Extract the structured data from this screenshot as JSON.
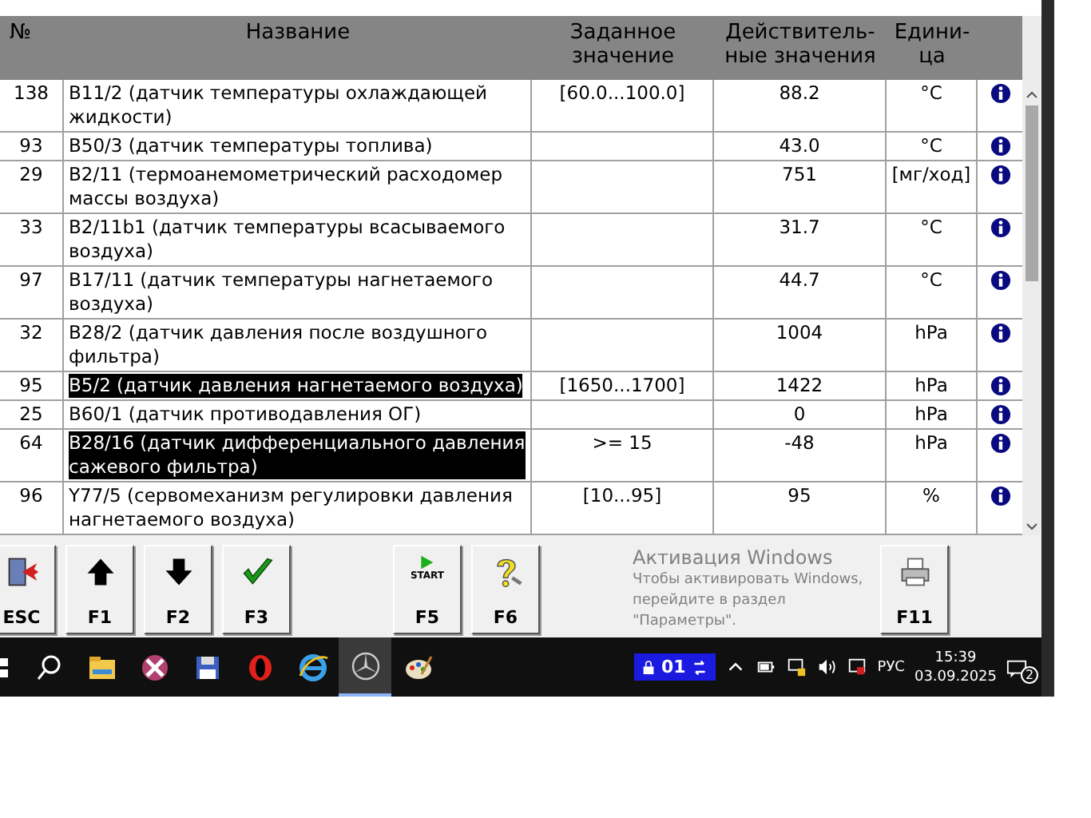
{
  "table": {
    "columns": [
      "№",
      "Название",
      "Заданное значение",
      "Действитель-ные значения",
      "Едини-ца"
    ],
    "rows": [
      {
        "no": "138",
        "name": "B11/2 (датчик температуры охлаждающей жидкости)",
        "set": "[60.0...100.0]",
        "actual": "88.2",
        "unit": "°C",
        "selected": false
      },
      {
        "no": "93",
        "name": "B50/3 (датчик температуры топлива)",
        "set": "",
        "actual": "43.0",
        "unit": "°C",
        "selected": false
      },
      {
        "no": "29",
        "name": "B2/11 (термоанемометрический расходомер массы воздуха)",
        "set": "",
        "actual": "751",
        "unit": "[мг/ход]",
        "selected": false
      },
      {
        "no": "33",
        "name": "B2/11b1 (датчик температуры всасываемого воздуха)",
        "set": "",
        "actual": "31.7",
        "unit": "°C",
        "selected": false
      },
      {
        "no": "97",
        "name": "B17/11 (датчик температуры нагнетаемого воздуха)",
        "set": "",
        "actual": "44.7",
        "unit": "°C",
        "selected": false
      },
      {
        "no": "32",
        "name": "B28/2 (датчик давления после воздушного фильтра)",
        "set": "",
        "actual": "1004",
        "unit": "hPa",
        "selected": false
      },
      {
        "no": "95",
        "name": "B5/2 (датчик давления нагнетаемого воздуха)",
        "set": "[1650...1700]",
        "actual": "1422",
        "unit": "hPa",
        "selected": true
      },
      {
        "no": "25",
        "name": "B60/1 (датчик противодавления ОГ)",
        "set": "",
        "actual": "0",
        "unit": "hPa",
        "selected": false
      },
      {
        "no": "64",
        "name": "B28/16 (датчик дифференциального давления сажевого фильтра)",
        "set": ">= 15",
        "actual": "-48",
        "unit": "hPa",
        "selected": true
      },
      {
        "no": "96",
        "name": "Y77/5 (сервомеханизм регулировки давления нагнетаемого воздуха)",
        "set": "[10...95]",
        "actual": "95",
        "unit": "%",
        "selected": false
      }
    ]
  },
  "toolbar": {
    "groups": [
      [
        {
          "label": "ESC",
          "kind": "exit"
        },
        {
          "label": "F1",
          "kind": "up"
        },
        {
          "label": "F2",
          "kind": "down"
        },
        {
          "label": "F3",
          "kind": "check"
        }
      ],
      [
        {
          "label": "F5",
          "kind": "start",
          "icon_text": "START"
        },
        {
          "label": "F6",
          "kind": "help"
        }
      ],
      [
        {
          "label": "F11",
          "kind": "print"
        }
      ]
    ]
  },
  "activation_notice": {
    "title": "Активация Windows",
    "text": "Чтобы активировать Windows, перейдите в раздел \"Параметры\"."
  },
  "taskbar": {
    "apps": [
      {
        "kind": "search",
        "selected": false
      },
      {
        "kind": "folder",
        "selected": false
      },
      {
        "kind": "tool",
        "selected": false
      },
      {
        "kind": "disk",
        "selected": false
      },
      {
        "kind": "opera",
        "selected": false
      },
      {
        "kind": "ie",
        "selected": false
      },
      {
        "kind": "star",
        "selected": true
      },
      {
        "kind": "paint",
        "selected": false
      }
    ],
    "indicator": "01",
    "language": "РУС",
    "time": "15:39",
    "date": "03.09.2025",
    "notifications": "2"
  }
}
